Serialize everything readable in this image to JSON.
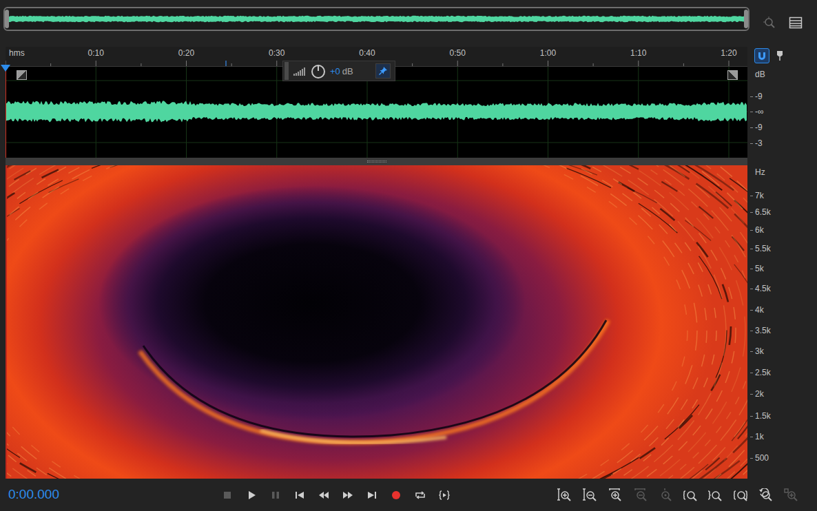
{
  "playhead": 0,
  "overview": {
    "view_start": 0,
    "view_end": 1
  },
  "ruler": {
    "unit": "hms",
    "ticks": [
      "0:10",
      "0:20",
      "0:30",
      "0:40",
      "0:50",
      "1:00",
      "1:10",
      "1:20"
    ]
  },
  "snap": {
    "on": true
  },
  "hud": {
    "gain": "+0",
    "unit": "dB",
    "pinned": true
  },
  "db_axis": {
    "unit": "dB",
    "labels": [
      "-9",
      "-∞",
      "-9",
      "-3"
    ]
  },
  "hz_axis": {
    "unit": "Hz",
    "labels": [
      "7k",
      "6.5k",
      "6k",
      "5.5k",
      "5k",
      "4.5k",
      "4k",
      "3.5k",
      "3k",
      "2.5k",
      "2k",
      "1.5k",
      "1k",
      "500"
    ]
  },
  "time": "0:00.000",
  "transport": [
    {
      "kind": "stop",
      "disabled": true
    },
    {
      "kind": "play",
      "disabled": false
    },
    {
      "kind": "pause",
      "disabled": true
    },
    {
      "kind": "start",
      "disabled": false
    },
    {
      "kind": "rewind",
      "disabled": false
    },
    {
      "kind": "forward",
      "disabled": false
    },
    {
      "kind": "end",
      "disabled": false
    },
    {
      "kind": "record",
      "disabled": false
    },
    {
      "kind": "loop",
      "disabled": false
    },
    {
      "kind": "skip",
      "disabled": false
    }
  ],
  "zoom_tools": [
    {
      "kind": "amp-in",
      "disabled": false
    },
    {
      "kind": "amp-out",
      "disabled": false
    },
    {
      "kind": "time-in",
      "disabled": false
    },
    {
      "kind": "time-out",
      "disabled": true
    },
    {
      "kind": "full",
      "disabled": true
    },
    {
      "kind": "in-point",
      "disabled": false
    },
    {
      "kind": "out-point",
      "disabled": false
    },
    {
      "kind": "selection",
      "disabled": false
    },
    {
      "kind": "playhead",
      "disabled": false
    },
    {
      "kind": "spectral",
      "disabled": true
    }
  ]
}
